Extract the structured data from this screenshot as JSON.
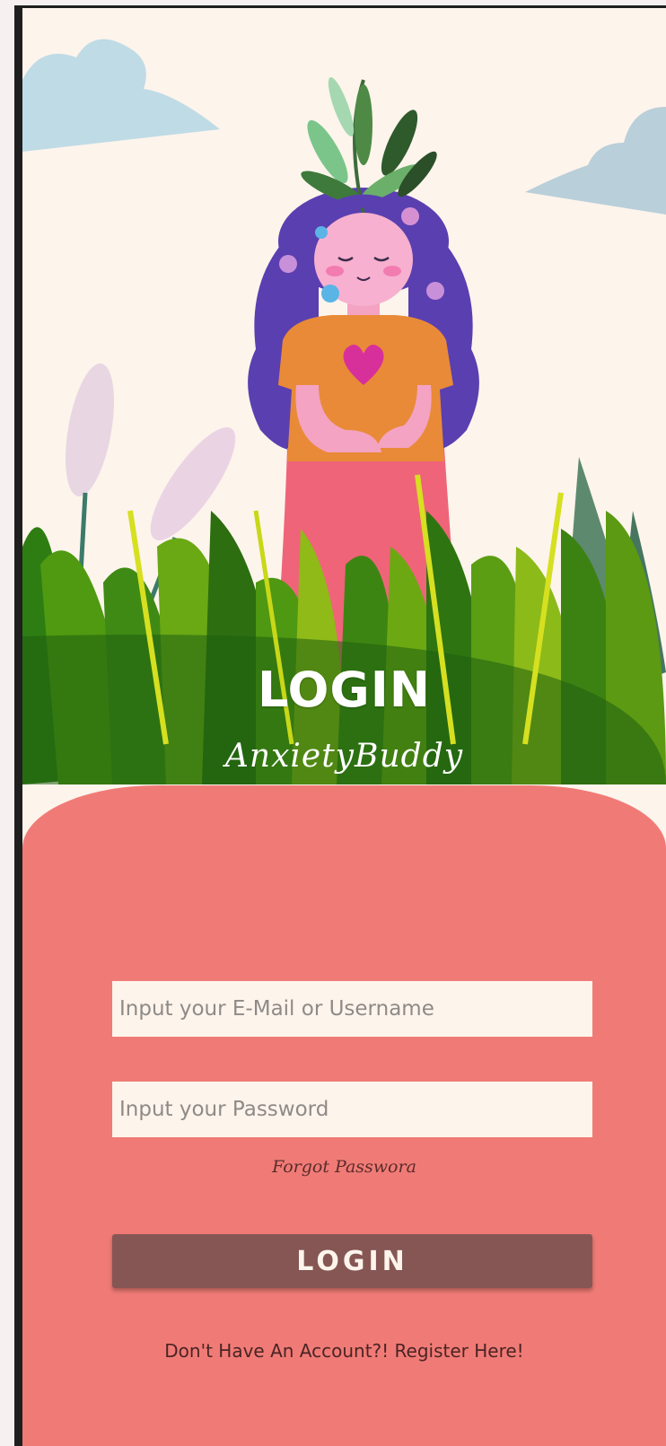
{
  "header": {
    "title": "LOGIN",
    "subtitle": "AnxietyBuddy",
    "illustration": "woman-with-plant-hair-in-grass-illustration"
  },
  "form": {
    "email_placeholder": "Input your E-Mail or Username",
    "email_value": "",
    "password_placeholder": "Input your Password",
    "password_value": "",
    "forgot_label": "Forgot Passwora",
    "login_label": "LOGIN",
    "register_label": "Don't Have An Account?! Register Here!"
  },
  "colors": {
    "background": "#fdf4ec",
    "panel": "#f07b76",
    "button": "#855654",
    "field": "#fdf4ec"
  }
}
